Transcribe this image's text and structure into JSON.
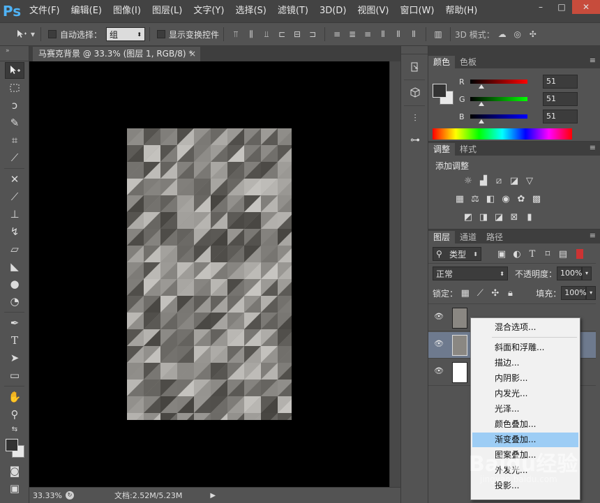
{
  "app": {
    "logo": "Ps",
    "menu": [
      "文件(F)",
      "编辑(E)",
      "图像(I)",
      "图层(L)",
      "文字(Y)",
      "选择(S)",
      "滤镜(T)",
      "3D(D)",
      "视图(V)",
      "窗口(W)",
      "帮助(H)"
    ],
    "window_controls": [
      "–",
      "□",
      "✕"
    ]
  },
  "options": {
    "auto_select_label": "自动选择：",
    "auto_select_value": "组",
    "show_transform_label": "显示变换控件",
    "mode_3d_label": "3D 模式："
  },
  "document": {
    "tab_title": "马赛克背景 @ 33.3% (图层 1, RGB/8) *",
    "close": "×",
    "zoom": "33.33%",
    "doc_info": "文档:2.52M/5.23M"
  },
  "color_panel": {
    "tabs": [
      "颜色",
      "色板"
    ],
    "channels": [
      {
        "label": "R",
        "value": "51",
        "grad_from": "#000000",
        "grad_to": "#ff0000"
      },
      {
        "label": "G",
        "value": "51",
        "grad_from": "#000000",
        "grad_to": "#00ff00"
      },
      {
        "label": "B",
        "value": "51",
        "grad_from": "#000000",
        "grad_to": "#0000ff"
      }
    ],
    "thumb_level": 0.2
  },
  "adjust_panel": {
    "tabs": [
      "调整",
      "样式"
    ],
    "title": "添加调整"
  },
  "layers_panel": {
    "tabs": [
      "图层",
      "通道",
      "路径"
    ],
    "filter_kind": "类型",
    "blend_mode": "正常",
    "opacity_label": "不透明度：",
    "opacity_value": "100%",
    "lock_label": "锁定：",
    "fill_label": "填充：",
    "fill_value": "100%"
  },
  "context_menu": {
    "items": [
      "混合选项...",
      "斜面和浮雕...",
      "描边...",
      "内阴影...",
      "内发光...",
      "光泽...",
      "颜色叠加...",
      "渐变叠加...",
      "图案叠加...",
      "外发光...",
      "投影..."
    ],
    "highlighted_index": 7
  },
  "watermark": {
    "main": "Baidu经验",
    "sub": "jingyan.baidu.com"
  }
}
